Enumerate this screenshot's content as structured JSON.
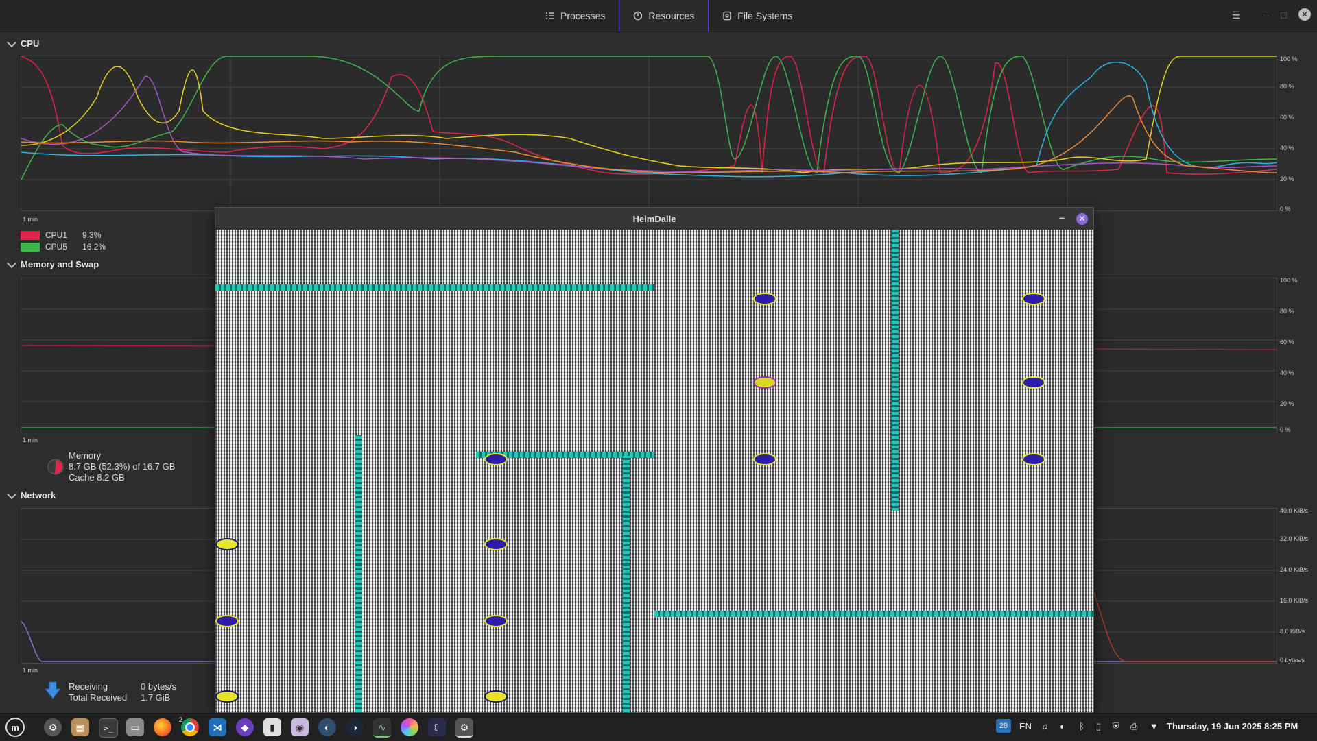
{
  "header": {
    "tabs": [
      {
        "label": "Processes",
        "icon": "list-icon"
      },
      {
        "label": "Resources",
        "icon": "gauge-icon"
      },
      {
        "label": "File Systems",
        "icon": "disk-icon"
      }
    ],
    "active_tab": "Resources"
  },
  "cpu": {
    "title": "CPU",
    "time_label": "1 min",
    "axis": [
      "100 %",
      "80 %",
      "60 %",
      "40 %",
      "20 %",
      "0 %"
    ],
    "legend": [
      {
        "name": "CPU1",
        "value": "9.3%",
        "color": "#e3244b"
      },
      {
        "name": "CPU5",
        "value": "16.2%",
        "color": "#3fb64b"
      }
    ]
  },
  "memory": {
    "title": "Memory and Swap",
    "time_label": "1 min",
    "axis": [
      "100 %",
      "80 %",
      "60 %",
      "40 %",
      "20 %",
      "0 %"
    ],
    "label": "Memory",
    "usage": "8.7 GB (52.3%) of 16.7 GB",
    "cache": "Cache 8.2 GB",
    "fraction": 0.523
  },
  "network": {
    "title": "Network",
    "time_label": "1 min",
    "axis": [
      "40.0 KiB/s",
      "32.0 KiB/s",
      "24.0 KiB/s",
      "16.0 KiB/s",
      "8.0 KiB/s",
      "0 bytes/s"
    ],
    "receiving_label": "Receiving",
    "receiving_value": "0 bytes/s",
    "total_label": "Total Received",
    "total_value": "1.7 GiB"
  },
  "heimdalle": {
    "title": "HeimDalle"
  },
  "taskbar": {
    "apps": [
      "mint-menu-icon",
      "settings-icon",
      "archive-icon",
      "terminal-icon",
      "files-icon",
      "firefox-icon",
      "chrome-icon",
      "vscode-icon",
      "app-icon",
      "twitch-icon",
      "camera-icon",
      "steam-icon",
      "steam-2-icon",
      "system-monitor-icon",
      "color-icon",
      "moon-icon",
      "heimdalle-icon"
    ],
    "chrome_badge": "2",
    "tray": {
      "calendar_day": "28",
      "lang": "EN",
      "datetime": "Thursday, 19 Jun 2025  8:25 PM"
    }
  }
}
